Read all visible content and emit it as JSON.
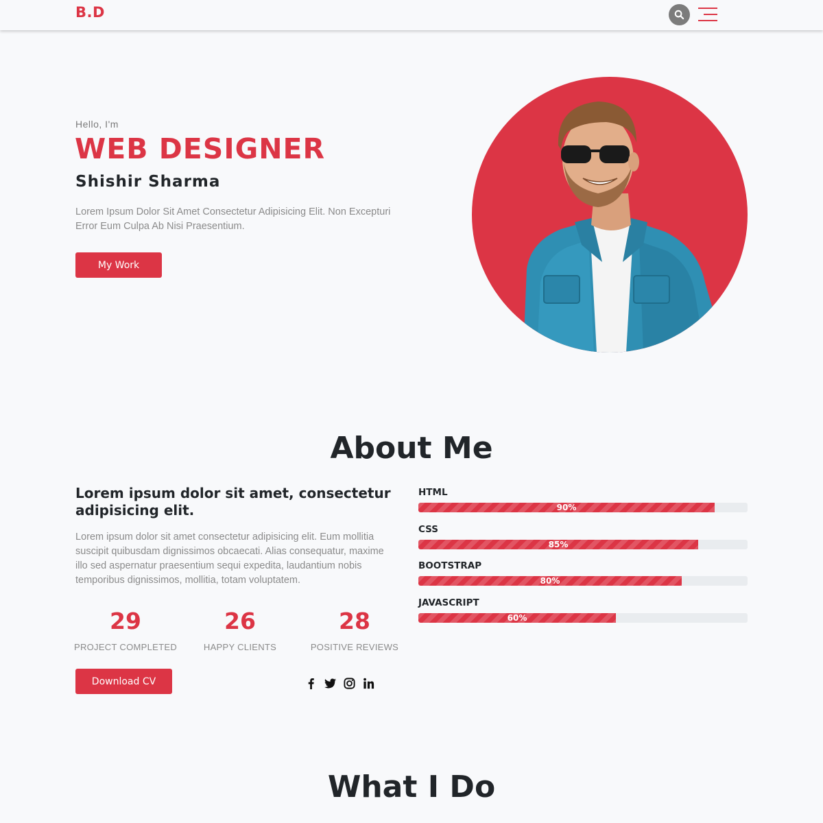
{
  "header": {
    "logo": "B.D",
    "search_icon": "search-icon",
    "menu_icon": "hamburger-menu-icon"
  },
  "hero": {
    "greeting": "Hello, I'm",
    "title": "WEB DESIGNER",
    "name": "Shishir Sharma",
    "description": "Lorem Ipsum Dolor Sit Amet Consectetur Adipisicing Elit. Non Excepturi Error Eum Culpa Ab Nisi Praesentium.",
    "button_label": "My Work"
  },
  "about": {
    "title": "About Me",
    "heading": "Lorem ipsum dolor sit amet, consectetur adipisicing elit.",
    "text": "Lorem ipsum dolor sit amet consectetur adipisicing elit. Eum mollitia suscipit quibusdam dignissimos obcaecati. Alias consequatur, maxime illo sed aspernatur praesentium sequi expedita, laudantium nobis temporibus dignissimos, mollitia, totam voluptatem.",
    "stats": [
      {
        "value": "29",
        "label": "PROJECT COMPLETED"
      },
      {
        "value": "26",
        "label": "HAPPY CLIENTS"
      },
      {
        "value": "28",
        "label": "POSITIVE REVIEWS"
      }
    ],
    "download_label": "Download CV",
    "socials": [
      "facebook-icon",
      "twitter-icon",
      "instagram-icon",
      "linkedin-icon"
    ],
    "skills": [
      {
        "name": "HTML",
        "label": "90%",
        "percent": 90
      },
      {
        "name": "CSS",
        "label": "85%",
        "percent": 85
      },
      {
        "name": "BOOTSTRAP",
        "label": "80%",
        "percent": 80
      },
      {
        "name": "JAVASCRIPT",
        "label": "60%",
        "percent": 60
      }
    ]
  },
  "services": {
    "title": "What I Do"
  },
  "colors": {
    "accent": "#dc3545",
    "background": "#f8f9fb",
    "text": "#212529",
    "muted": "#8a8a8a",
    "track": "#e9ecef"
  }
}
